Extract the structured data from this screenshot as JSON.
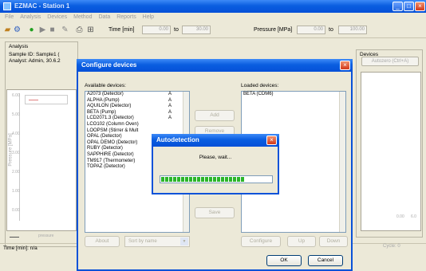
{
  "window": {
    "title": "EZMAC - Station 1"
  },
  "menu": [
    "File",
    "Analysis",
    "Devices",
    "Method",
    "Data",
    "Reports",
    "Help"
  ],
  "toolbar": {
    "time_label": "Time [min]",
    "time_from": "0.00",
    "time_to_label": "to",
    "time_to": "30.00",
    "pressure_label": "Pressure [MPa]",
    "pressure_from": "0.00",
    "pressure_to_label": "to",
    "pressure_to": "100.00"
  },
  "analysis": {
    "label": "Analysis",
    "sample": "Sample ID: Sample1 (",
    "analyst": "Analyst: Admin, 30.6.2",
    "y_axis_label": "Pressure [MPa]",
    "y_ticks": [
      "6.00",
      "5.00",
      "4.00",
      "3.00",
      "2.00",
      "1.00",
      "0.00"
    ],
    "legend_text": "",
    "bottom_legend": "pressure"
  },
  "status": {
    "time_text": "Time [min]: n/a"
  },
  "devices_panel": {
    "label": "Devices",
    "button": "Autozero (Ctrl+A)"
  },
  "right_graph": {
    "x_ticks": [
      "0.00",
      "6.0"
    ]
  },
  "cycle": "Cycle: 0",
  "dialog": {
    "title": "Configure devices",
    "available_label": "Available devices:",
    "loaded_label": "Loaded devices:",
    "available": [
      {
        "name": "A2073 (Detector)",
        "tag": "A"
      },
      {
        "name": "ALPHA (Pump)",
        "tag": "A"
      },
      {
        "name": "AQUILON (Detector)",
        "tag": "A"
      },
      {
        "name": "BETA (Pump)",
        "tag": "A"
      },
      {
        "name": "LCD2071.3 (Detector)",
        "tag": "A"
      },
      {
        "name": "LCO102 (Column Oven)",
        "tag": ""
      },
      {
        "name": "LOOPSM (Stirrer & Mult",
        "tag": ""
      },
      {
        "name": "OPAL (Detector)",
        "tag": ""
      },
      {
        "name": "OPAL DEMO (Detector)",
        "tag": ""
      },
      {
        "name": "RUBY (Detector)",
        "tag": ""
      },
      {
        "name": "SAPPHIRE (Detector)",
        "tag": ""
      },
      {
        "name": "TM917 (Thermometer)",
        "tag": ""
      },
      {
        "name": "TOPAZ (Detector)",
        "tag": ""
      }
    ],
    "loaded": [
      "BETA (CDM6)"
    ],
    "add": "Add",
    "remove": "Remove",
    "save": "Save",
    "about": "About",
    "sort_combo": "Sort by name",
    "configure": "Configure",
    "up": "Up",
    "down": "Down",
    "ok": "OK",
    "cancel": "Cancel"
  },
  "autodetect": {
    "title": "Autodetection",
    "message": "Please, wait...",
    "progress": 0.75
  },
  "colors": {
    "title_bar": "#0a5ee0",
    "progress": "#2bb52b",
    "close": "#d2391a"
  }
}
